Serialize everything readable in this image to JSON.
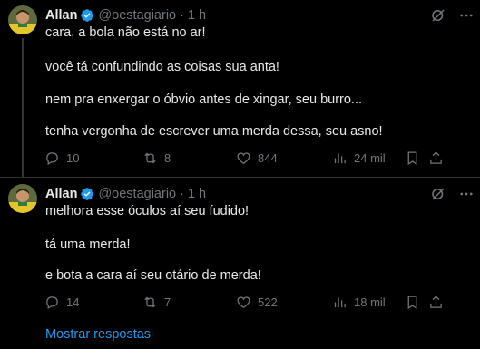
{
  "tweets": [
    {
      "author": "Allan",
      "handle": "@oestagiario",
      "separator": "·",
      "time": "1 h",
      "lines": [
        "cara, a bola não está no ar!",
        "você tá confundindo as coisas sua anta!",
        "nem pra enxergar o óbvio antes de xingar, seu burro...",
        "tenha vergonha de escrever uma merda dessa, seu asno!"
      ],
      "stats": {
        "replies": "10",
        "retweets": "8",
        "likes": "844",
        "views": "24 mil"
      }
    },
    {
      "author": "Allan",
      "handle": "@oestagiario",
      "separator": "·",
      "time": "1 h",
      "lines": [
        "melhora esse óculos aí seu fudido!",
        "tá uma merda!",
        "e bota a cara aí seu otário de merda!"
      ],
      "stats": {
        "replies": "14",
        "retweets": "7",
        "likes": "522",
        "views": "18 mil"
      }
    }
  ],
  "show_replies": "Mostrar respostas",
  "colors": {
    "background": "#000000",
    "text": "#e7e9ea",
    "muted": "#71767b",
    "accent": "#1d9bf0"
  }
}
